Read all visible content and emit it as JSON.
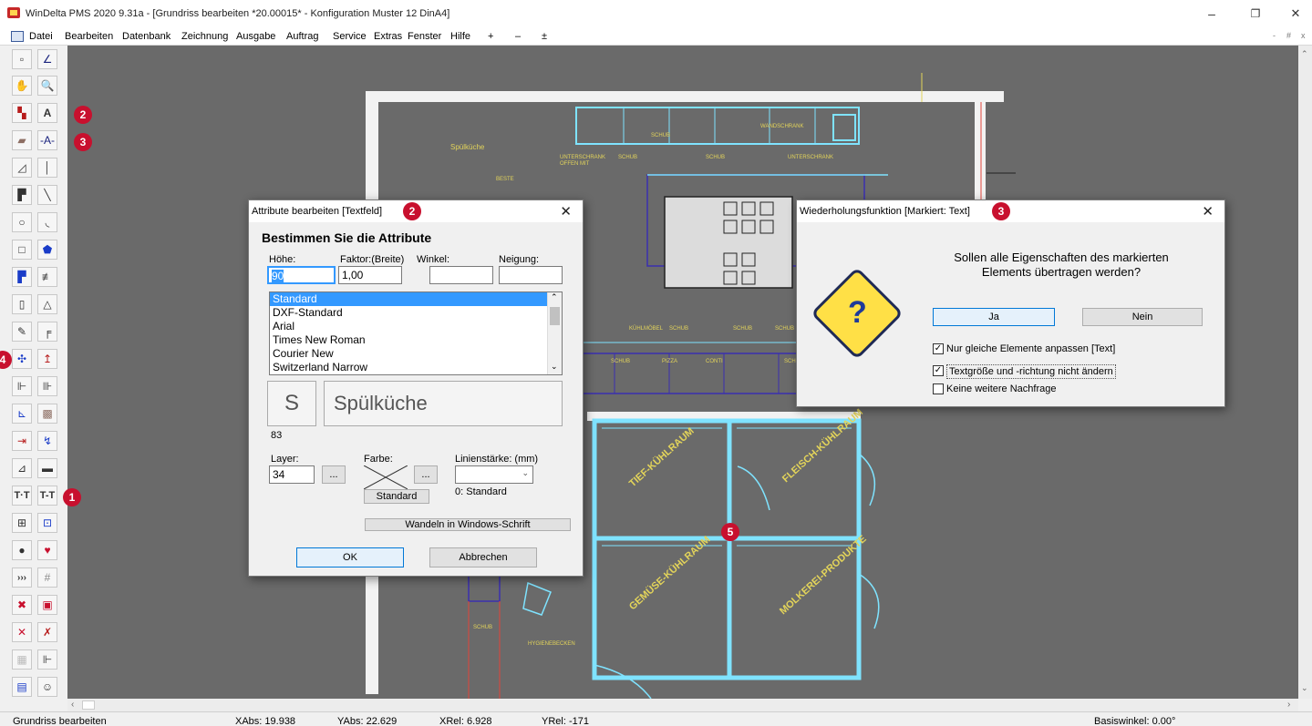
{
  "window": {
    "title": "WinDelta PMS 2020 9.31a - [Grundriss bearbeiten *20.00015* - Konfiguration Muster 12 DinA4]",
    "minimize": "–",
    "restore": "❐",
    "close": "✕",
    "mdi_controls": [
      "-",
      "#",
      "x"
    ]
  },
  "menu": {
    "items": [
      "Datei",
      "Bearbeiten",
      "Datenbank",
      "Zeichnung",
      "Ausgabe",
      "Auftrag",
      "Service",
      "Extras",
      "Fenster",
      "Hilfe",
      "+",
      "–",
      "±"
    ]
  },
  "badges": [
    "1",
    "2",
    "3",
    "4",
    "5"
  ],
  "rooms": {
    "room1": "TIEF-KÜHLRAUM",
    "room2": "FLEISCH-KÜHLRAUM",
    "room3": "GEMÜSE-KÜHLRAUM",
    "room4": "MOLKEREI-PRODUKTE",
    "kitchen": "Spülküche"
  },
  "attr_dialog": {
    "title": "Attribute bearbeiten [Textfeld]",
    "heading": "Bestimmen Sie die Attribute",
    "labels": {
      "hoehe": "Höhe:",
      "faktor": "Faktor:(Breite)",
      "winkel": "Winkel:",
      "neigung": "Neigung:",
      "layer": "Layer:",
      "farbe": "Farbe:",
      "linienstaerke": "Linienstärke: (mm)"
    },
    "values": {
      "hoehe": "90",
      "faktor": "1,00",
      "winkel": "",
      "neigung": "",
      "layer": "34",
      "linienstaerke": ""
    },
    "fonts": [
      "Standard",
      "DXF-Standard",
      "Arial",
      "Times New Roman",
      "Courier New",
      "Switzerland Narrow"
    ],
    "selected_font": "Standard",
    "preview_glyph": "S",
    "preview_text": "Spülküche",
    "font_code": "83",
    "farbe_button": "Standard",
    "linien_caption": "0: Standard",
    "browse": "...",
    "wandeln_button": "Wandeln in Windows-Schrift",
    "ok_button": "OK",
    "cancel_button": "Abbrechen"
  },
  "repeat_dialog": {
    "title": "Wiederholungsfunktion [Markiert: Text]",
    "question_line1": "Sollen alle Eigenschaften des markierten",
    "question_line2": "Elements übertragen werden?",
    "ja_button": "Ja",
    "nein_button": "Nein",
    "options": [
      {
        "label": "Nur gleiche Elemente anpassen [Text]",
        "checked": true
      },
      {
        "label": "Textgröße und -richtung nicht ändern",
        "checked": true
      },
      {
        "label": "Keine weitere Nachfrage",
        "checked": false
      }
    ]
  },
  "status": {
    "mode": "Grundriss bearbeiten",
    "xabs": "XAbs: 19.938",
    "yabs": "YAbs: 22.629",
    "xrel": "XRel: 6.928",
    "yrel": "YRel: -171",
    "basis": "Basiswinkel: 0.00°"
  },
  "colors": {
    "canvas": "#6a6a6a",
    "cad_cyan": "#7fe3ff",
    "cad_yellow": "#e3d45a",
    "cad_blue": "#3a2fb0",
    "badge": "#c8102e",
    "selection": "#3399ff"
  }
}
